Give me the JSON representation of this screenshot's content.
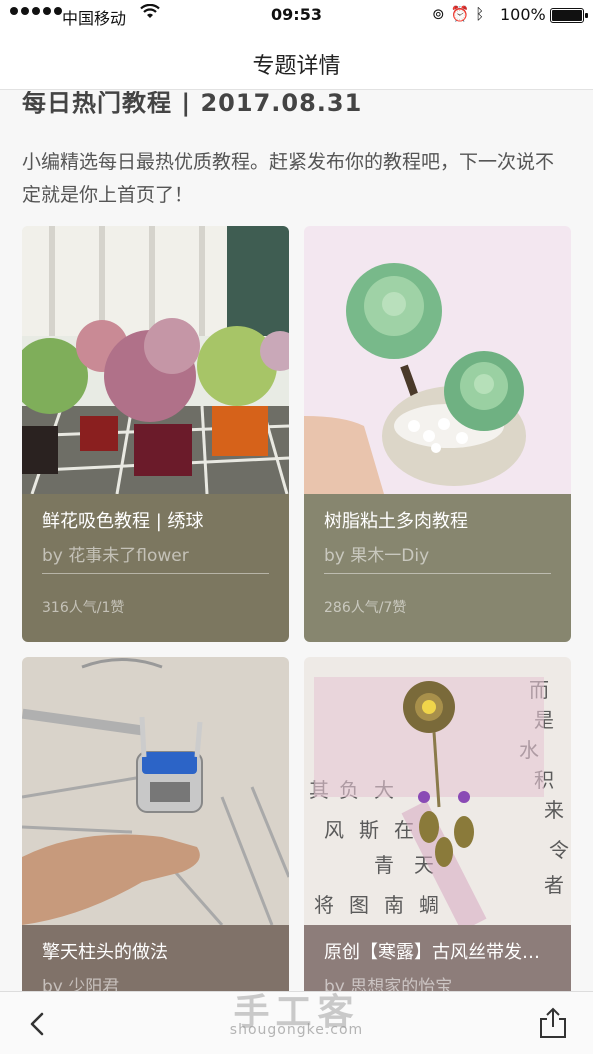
{
  "status_bar": {
    "carrier": "中国移动",
    "time": "09:53",
    "battery": "100%"
  },
  "nav": {
    "title": "专题详情"
  },
  "topic": {
    "title": "每日热门教程 | 2017.08.31",
    "description": "小编精选每日最热优质教程。赶紧发布你的教程吧，下一次说不定就是你上首页了！"
  },
  "cards": [
    {
      "title": "鲜花吸色教程 | 绣球",
      "author": "by 花事未了flower",
      "stats": "316人气/1赞",
      "color": "#7c7760"
    },
    {
      "title": "树脂粘土多肉教程",
      "author": "by 果木一Diy",
      "stats": "286人气/7赞",
      "color": "#87866f"
    },
    {
      "title": "擎天柱头的做法",
      "author": "by 少阳君",
      "stats": "",
      "color": "#807269"
    },
    {
      "title": "原创【寒露】古风丝带发簪教程",
      "author": "by 思想家的怡宝",
      "stats": "",
      "color": "#8d7d7a"
    }
  ],
  "watermark": {
    "cn": "手工客",
    "en": "shougongke.com"
  },
  "icons": {
    "back": "chevron-left-icon",
    "share": "share-icon",
    "wifi": "wifi-icon",
    "lock": "rotation-lock-icon",
    "alarm": "alarm-icon",
    "bluetooth": "bluetooth-icon"
  }
}
